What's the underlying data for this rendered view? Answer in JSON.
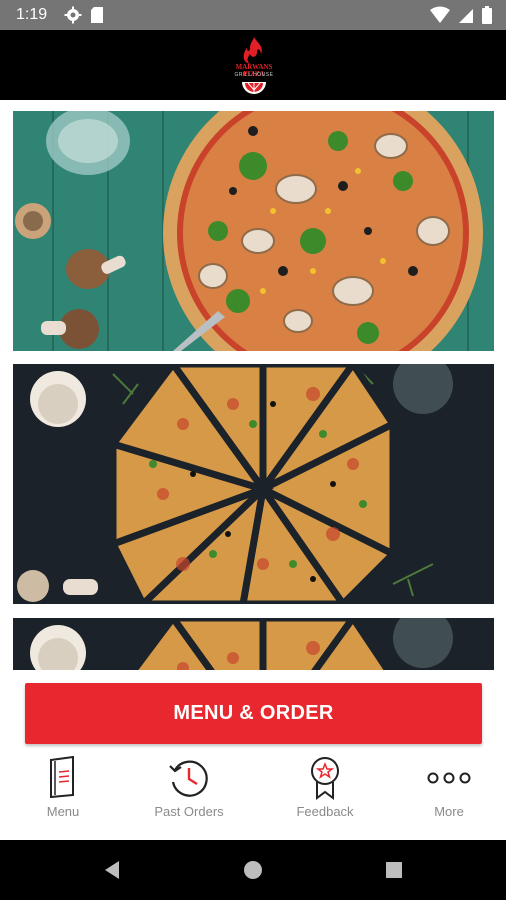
{
  "status_bar": {
    "time": "1:19",
    "icons_left": [
      "gear-icon",
      "sd-card-icon"
    ],
    "icons_right": [
      "wifi-icon",
      "cell-signal-icon",
      "battery-icon"
    ]
  },
  "header": {
    "logo_name": "MARWANS PIZZA",
    "logo_tagline": "GRILL HOUSE"
  },
  "feed": {
    "images": [
      "pizza-photo-vegetables",
      "pizza-photo-sliced",
      "pizza-photo-sliced-partial"
    ]
  },
  "cta": {
    "label": "MENU & ORDER"
  },
  "bottom_nav": {
    "items": [
      {
        "label": "Menu",
        "icon": "menu-book-icon"
      },
      {
        "label": "Past Orders",
        "icon": "history-clock-icon"
      },
      {
        "label": "Feedback",
        "icon": "award-ribbon-icon"
      },
      {
        "label": "More",
        "icon": "more-dots-icon"
      }
    ]
  },
  "colors": {
    "accent_red": "#e9272e",
    "header_bg": "#000000",
    "status_bar_bg": "#757575"
  }
}
